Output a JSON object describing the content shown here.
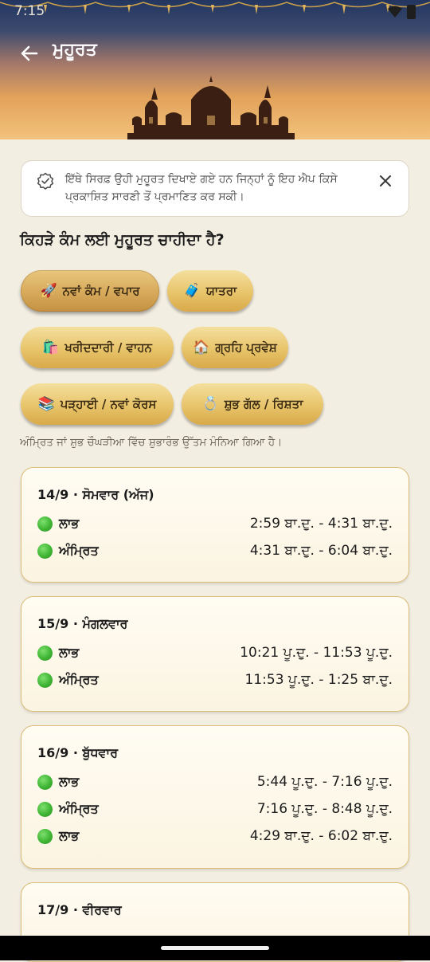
{
  "status_bar": {
    "time": "7:15"
  },
  "header": {
    "title": "ਮੁਹੂਰਤ"
  },
  "banner": {
    "text": "ਇੱਥੇ ਸਿਰਫ਼ ਉਹੀ ਮੁਹੂਰਤ ਦਿਖਾਏ ਗਏ ਹਨ ਜਿਨ੍ਹਾਂ ਨੂੰ ਇਹ ਐਪ ਕਿਸੇ ਪ੍ਰਕਾਸ਼ਿਤ ਸਾਰਣੀ ਤੋਂ ਪ੍ਰਮਾਣਿਤ ਕਰ ਸਕੀ।"
  },
  "question": "ਕਿਹੜੇ ਕੰਮ ਲਈ ਮੁਹੂਰਤ ਚਾਹੀਦਾ ਹੈ?",
  "chips": [
    {
      "emoji": "🚀",
      "label": "ਨਵਾਂ ਕੰਮ / ਵਪਾਰ",
      "selected": true
    },
    {
      "emoji": "🧳",
      "label": "ਯਾਤਰਾ",
      "selected": false
    },
    {
      "emoji": "🛍️",
      "label": "ਖਰੀਦਦਾਰੀ / ਵਾਹਨ",
      "selected": false
    },
    {
      "emoji": "🏠",
      "label": "ਗ੍ਰਹਿ ਪ੍ਰਵੇਸ਼",
      "selected": false
    },
    {
      "emoji": "📚",
      "label": "ਪੜ੍ਹਾਈ / ਨਵਾਂ ਕੋਰਸ",
      "selected": false
    },
    {
      "emoji": "💍",
      "label": "ਸ਼ੁਭ ਗੱਲ / ਰਿਸ਼ਤਾ",
      "selected": false
    }
  ],
  "note": "ਅੰਮ੍ਰਿਤ ਜਾਂ ਸ਼ੁਭ ਚੌਘੜੀਆ ਵਿੱਚ ਸ਼ੁਭਾਰੰਭ ਉੱਤਮ ਮੰਨਿਆ ਗਿਆ ਹੈ।",
  "days": [
    {
      "date": "14/9 · ਸੋਮਵਾਰ (ਅੱਜ)",
      "slots": [
        {
          "name": "ਲਾਭ",
          "time": "2:59 ਬਾ.ਦੁ. - 4:31 ਬਾ.ਦੁ."
        },
        {
          "name": "ਅੰਮ੍ਰਿਤ",
          "time": "4:31 ਬਾ.ਦੁ. - 6:04 ਬਾ.ਦੁ."
        }
      ]
    },
    {
      "date": "15/9 · ਮੰਗਲਵਾਰ",
      "slots": [
        {
          "name": "ਲਾਭ",
          "time": "10:21 ਪੂ.ਦੁ. - 11:53 ਪੂ.ਦੁ."
        },
        {
          "name": "ਅੰਮ੍ਰਿਤ",
          "time": "11:53 ਪੂ.ਦੁ. - 1:25 ਬਾ.ਦੁ."
        }
      ]
    },
    {
      "date": "16/9 · ਬੁੱਧਵਾਰ",
      "slots": [
        {
          "name": "ਲਾਭ",
          "time": "5:44 ਪੂ.ਦੁ. - 7:16 ਪੂ.ਦੁ."
        },
        {
          "name": "ਅੰਮ੍ਰਿਤ",
          "time": "7:16 ਪੂ.ਦੁ. - 8:48 ਪੂ.ਦੁ."
        },
        {
          "name": "ਲਾਭ",
          "time": "4:29 ਬਾ.ਦੁ. - 6:02 ਬਾ.ਦੁ."
        }
      ]
    },
    {
      "date": "17/9 · ਵੀਰਵਾਰ",
      "slots": []
    }
  ],
  "colors": {
    "accent_gold": "#e8c46a",
    "slot_dot": "#3fb534",
    "background": "#f3eee2"
  }
}
